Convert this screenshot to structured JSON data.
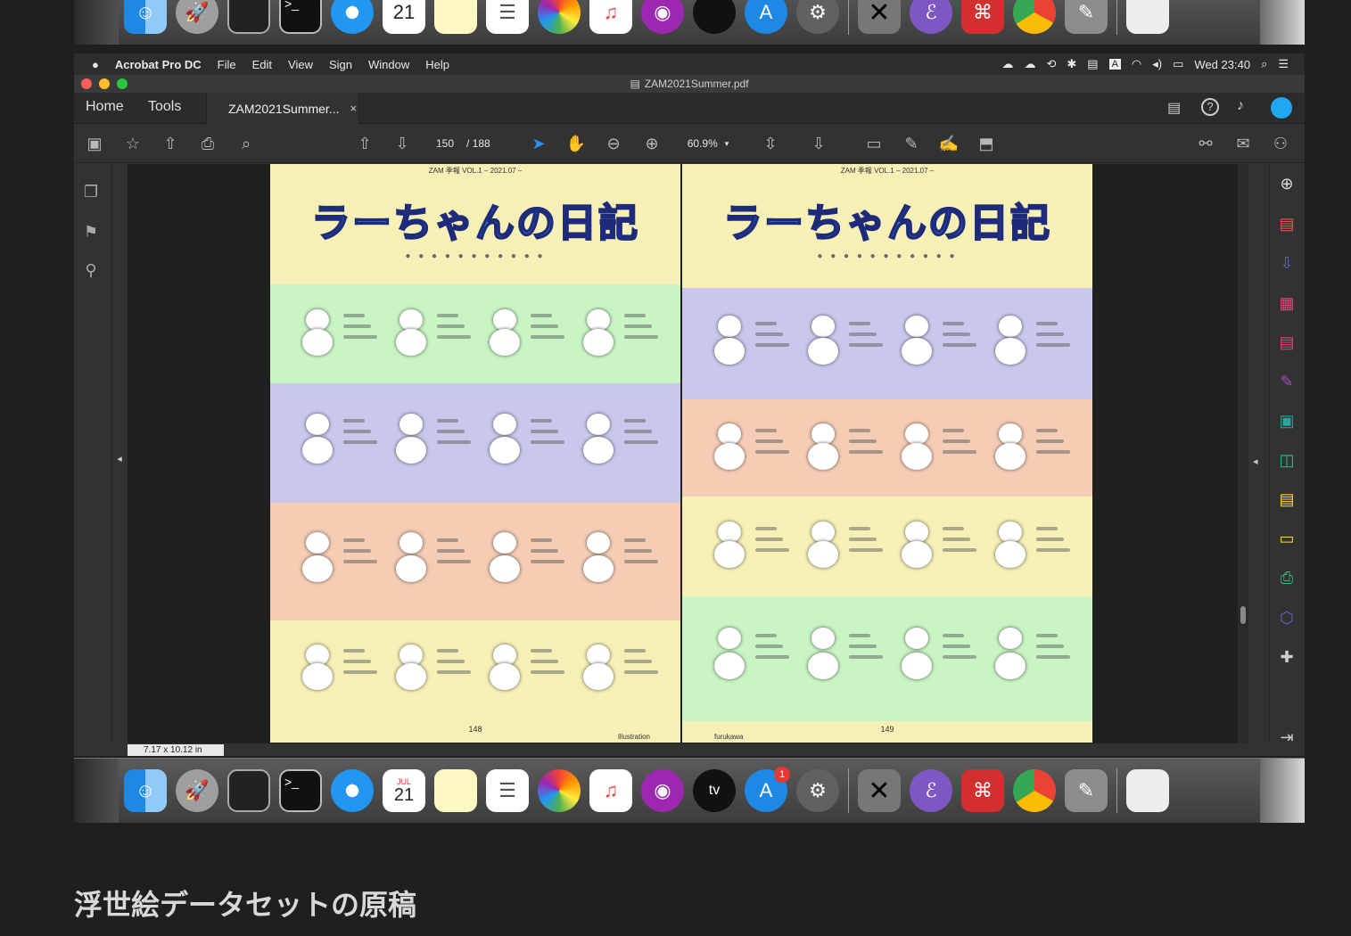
{
  "dock": {
    "calendar_month": "JUL",
    "calendar_day": "21",
    "appletv_label": "tv",
    "appstore_badge": "1",
    "apps": [
      "Finder",
      "Launchpad",
      "Activity Monitor",
      "Terminal",
      "Safari",
      "Calendar",
      "Notes",
      "Reminders",
      "Photos",
      "Music",
      "Podcasts",
      "TV",
      "App Store",
      "System Preferences",
      "X11",
      "Emacs",
      "Acrobat",
      "Chrome",
      "GIMP",
      "Preview",
      "Trash"
    ]
  },
  "menubar": {
    "app_name": "Acrobat Pro DC",
    "items": [
      "File",
      "Edit",
      "View",
      "Sign",
      "Window",
      "Help"
    ],
    "clock": "Wed 23:40"
  },
  "window": {
    "title": "ZAM2021Summer.pdf",
    "nav_tabs": [
      "Home",
      "Tools"
    ],
    "doc_tab": "ZAM2021Summer...",
    "page_current": "150",
    "page_total": "/ 188",
    "zoom": "60.9%",
    "page_size": "7.17 x 10.12 in"
  },
  "pages": [
    {
      "header": "ZAM 季報 VOL.1 – 2021.07 –",
      "title": "ラーちゃんの日記",
      "number": "148",
      "credit": "illustration",
      "bands": [
        "#c9f5c4",
        "#c9c8ec",
        "#f5ccb4",
        "#f6f0b6"
      ]
    },
    {
      "header": "ZAM 季報 VOL.1 – 2021.07 –",
      "title": "ラーちゃんの日記",
      "number": "149",
      "credit": "furukawa",
      "bands": [
        "#c9c8ec",
        "#f5ccb4",
        "#f6f0b6",
        "#c9f5c4"
      ]
    }
  ],
  "caption": "浮世絵データセットの原稿"
}
